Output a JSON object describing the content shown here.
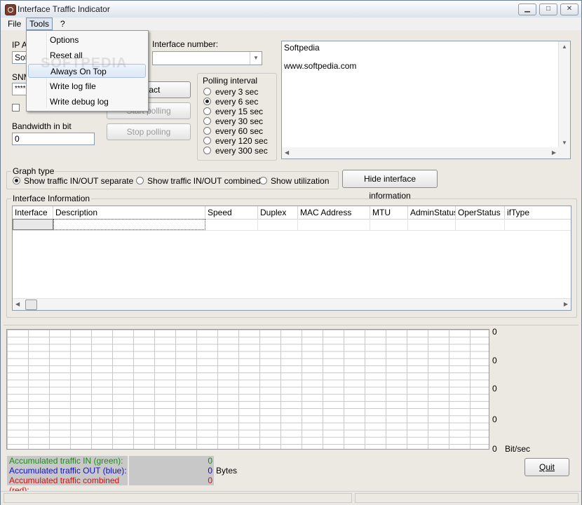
{
  "window": {
    "title": "Interface Traffic Indicator"
  },
  "menu": {
    "file": "File",
    "tools": "Tools",
    "help": "?",
    "tools_items": [
      "Options",
      "Reset all",
      "Always On Top",
      "Write log file",
      "Write debug log"
    ]
  },
  "watermark": "SOFTPEDIA",
  "left": {
    "ip_label": "IP A",
    "ip_value": "Sof",
    "snmp_label": "SNM",
    "snmp_value": "****",
    "bandwidth_label": "Bandwidth in bit",
    "bandwidth_value": "0"
  },
  "interface": {
    "label": "Interface number:",
    "value": ""
  },
  "buttons": {
    "contact": "ontact",
    "start_polling": "Start polling",
    "stop_polling": "Stop polling",
    "hide_info": "Hide interface information",
    "quit": "Quit"
  },
  "polling": {
    "title": "Polling interval",
    "options": [
      "every 3 sec",
      "every 6 sec",
      "every 15 sec",
      "every 30 sec",
      "every 60 sec",
      "every 120 sec",
      "every 300 sec"
    ],
    "selected": "every 6 sec"
  },
  "info_text": {
    "line1": "Softpedia",
    "line2": "www.softpedia.com"
  },
  "graph_type": {
    "title": "Graph type",
    "options": [
      "Show traffic IN/OUT separate",
      "Show traffic IN/OUT combined",
      "Show utilization"
    ],
    "selected": "Show traffic IN/OUT separate"
  },
  "interface_info": {
    "title": "Interface Information",
    "columns": [
      "Interface",
      "Description",
      "Speed",
      "Duplex",
      "MAC Address",
      "MTU",
      "AdminStatus",
      "OperStatus",
      "ifType"
    ]
  },
  "graph": {
    "axis_values": [
      "0",
      "0",
      "0",
      "0",
      "0"
    ],
    "unit": "Bit/sec"
  },
  "counters": {
    "in_label": "Accumulated traffic IN (green):",
    "in_value": "0",
    "out_label": "Accumulated traffic OUT (blue):",
    "out_value": "0",
    "combined_label": "Accumulated traffic combined (red):",
    "combined_value": "0",
    "unit": "Bytes"
  },
  "colors": {
    "in": "#1c8a1c",
    "out": "#1010d0",
    "combined": "#d01010"
  }
}
